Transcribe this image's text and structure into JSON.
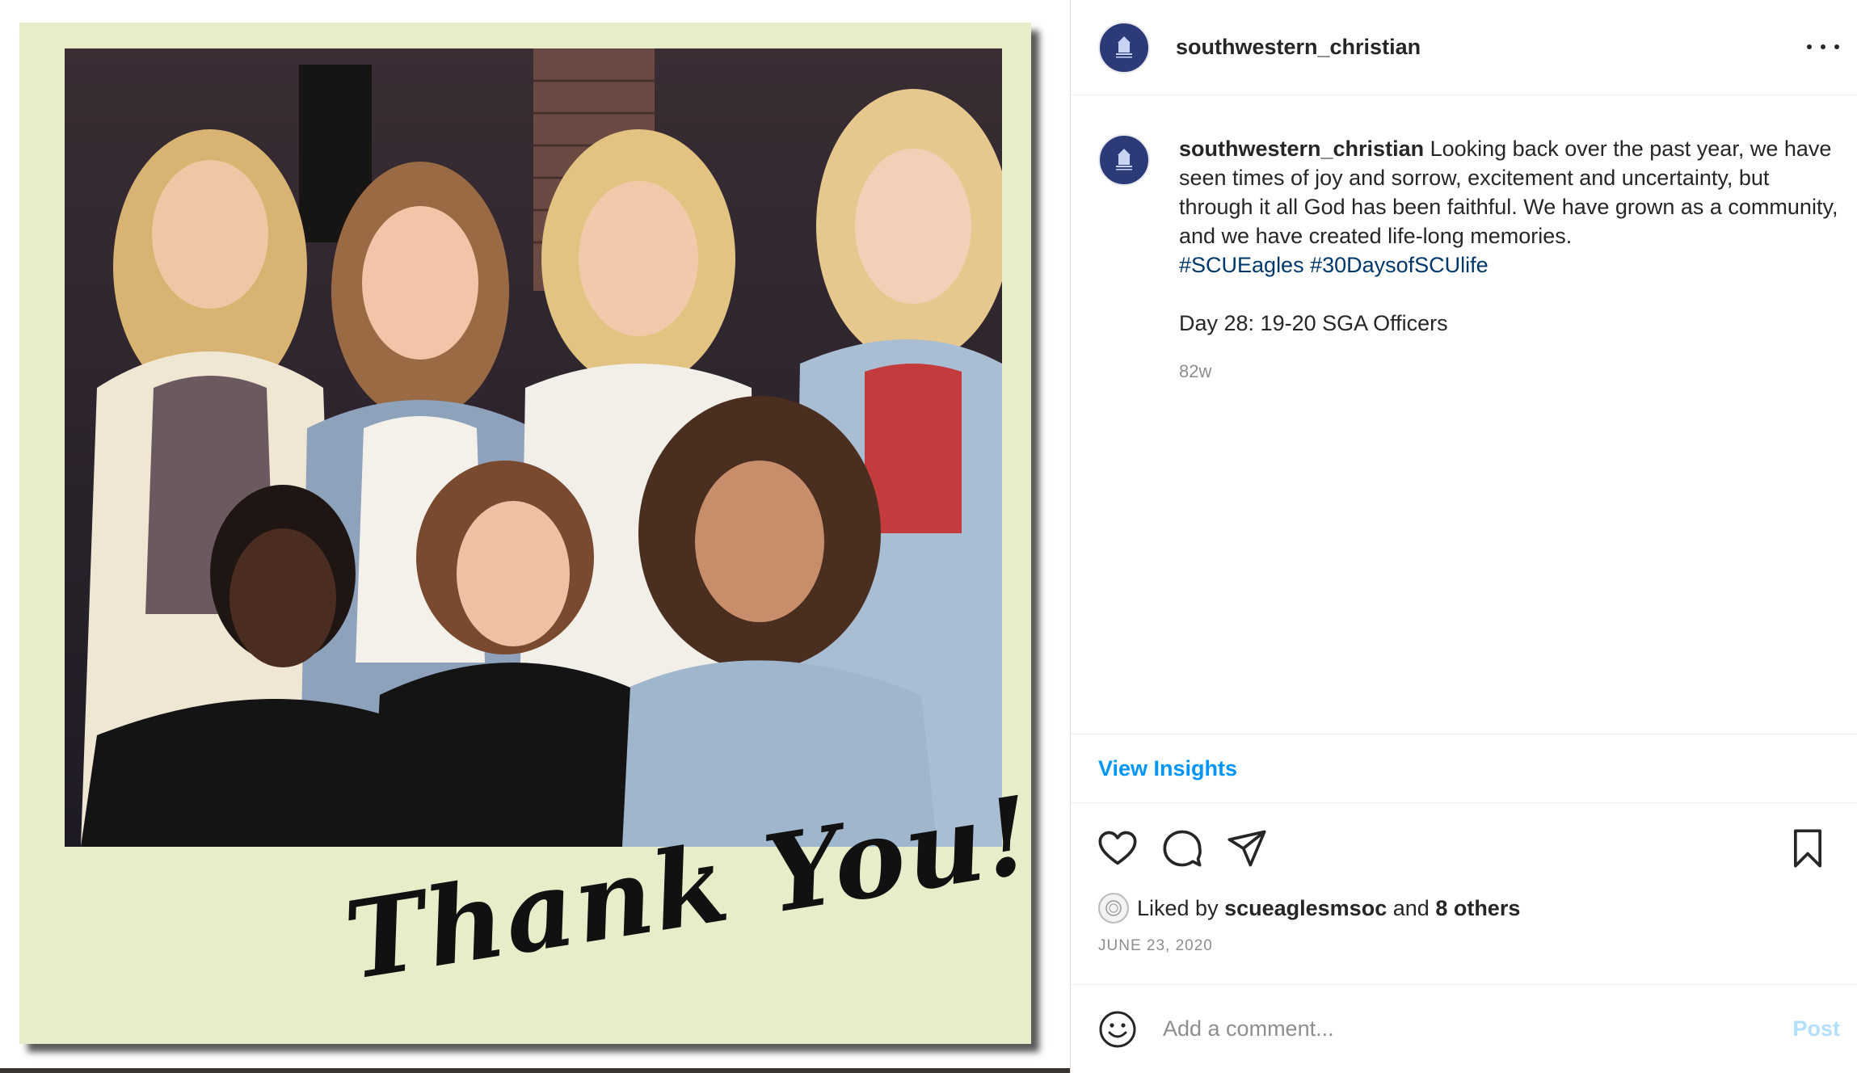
{
  "post": {
    "username": "southwestern_christian",
    "avatar_icon": "university-logo-icon",
    "image_overlay_text": "Thank You!",
    "caption": {
      "username": "southwestern_christian",
      "text": " Looking back over the past year, we have seen times of joy and sorrow, excitement and uncertainty, but through it all God has been faithful. We have grown as a community, and we have created life-long memories.",
      "hashtags": [
        "#SCUEagles",
        "#30DaysofSCUlife"
      ],
      "extra_line": "Day 28: 19-20 SGA Officers",
      "time_ago": "82w"
    },
    "insights_label": "View Insights",
    "actions": {
      "like_icon": "heart-icon",
      "comment_icon": "comment-icon",
      "share_icon": "share-icon",
      "save_icon": "bookmark-icon"
    },
    "likes": {
      "prefix": "Liked by",
      "user": "scueaglesmsoc",
      "conjunction": "and",
      "others": "8 others"
    },
    "date": "JUNE 23, 2020",
    "comment": {
      "placeholder": "Add a comment...",
      "post_label": "Post"
    }
  },
  "colors": {
    "link_blue": "#0095f6",
    "hashtag_blue": "#00376b",
    "polaroid_frame": "#e8ecc8",
    "avatar_navy": "#2d3a78"
  }
}
